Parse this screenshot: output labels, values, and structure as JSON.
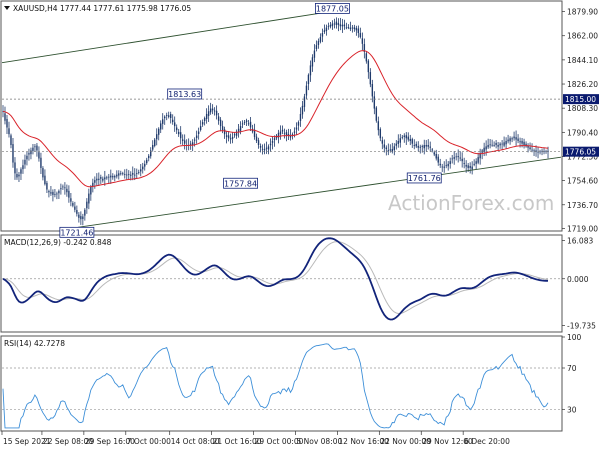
{
  "chart_data": [
    {
      "type": "candlestick",
      "symbol_header": "XAUUSD,H4  1777.44 1777.61 1775.98 1776.05",
      "ylim": [
        1718,
        1887
      ],
      "y_ticks": [
        1879.9,
        1862.0,
        1844.1,
        1826.2,
        1808.3,
        1790.4,
        1772.5,
        1754.6,
        1736.7,
        1719.0
      ],
      "n_bars": 280,
      "close": [
        1806,
        1799,
        1794,
        1789,
        1781,
        1768,
        1760,
        1757,
        1759,
        1763,
        1766,
        1770,
        1773,
        1775,
        1777,
        1779,
        1780,
        1777,
        1771,
        1764,
        1757,
        1752,
        1748,
        1746,
        1745,
        1744,
        1744,
        1745,
        1747,
        1749,
        1750,
        1749,
        1746,
        1742,
        1739,
        1736,
        1733,
        1730,
        1727,
        1726,
        1728,
        1733,
        1739,
        1745,
        1750,
        1753,
        1755,
        1756,
        1756,
        1756,
        1756,
        1757,
        1757,
        1757,
        1757,
        1758,
        1758,
        1759,
        1760,
        1760,
        1760,
        1759,
        1759,
        1759,
        1759,
        1759,
        1759,
        1760,
        1761,
        1763,
        1765,
        1767,
        1770,
        1773,
        1777,
        1781,
        1785,
        1789,
        1793,
        1797,
        1800,
        1802,
        1803,
        1803,
        1801,
        1798,
        1795,
        1792,
        1789,
        1786,
        1784,
        1782,
        1781,
        1781,
        1782,
        1783,
        1785,
        1788,
        1791,
        1795,
        1798,
        1801,
        1804,
        1806,
        1808,
        1808,
        1806,
        1803,
        1799,
        1795,
        1792,
        1789,
        1787,
        1786,
        1786,
        1787,
        1789,
        1791,
        1793,
        1795,
        1797,
        1798,
        1798,
        1797,
        1794,
        1791,
        1787,
        1784,
        1781,
        1779,
        1778,
        1778,
        1779,
        1780,
        1782,
        1784,
        1786,
        1788,
        1790,
        1791,
        1791,
        1790,
        1788,
        1788,
        1788,
        1789,
        1791,
        1794,
        1798,
        1804,
        1810,
        1817,
        1825,
        1833,
        1840,
        1846,
        1851,
        1855,
        1858,
        1861,
        1864,
        1866,
        1868,
        1869,
        1870,
        1871,
        1871,
        1870,
        1870,
        1869,
        1869,
        1869,
        1868,
        1868,
        1868,
        1868,
        1867,
        1866,
        1864,
        1861,
        1856,
        1850,
        1843,
        1835,
        1826,
        1817,
        1808,
        1799,
        1792,
        1786,
        1782,
        1779,
        1778,
        1777,
        1777,
        1778,
        1780,
        1782,
        1784,
        1786,
        1787,
        1787,
        1786,
        1785,
        1784,
        1782,
        1781,
        1780,
        1779,
        1779,
        1780,
        1781,
        1781,
        1781,
        1779,
        1777,
        1774,
        1771,
        1768,
        1766,
        1765,
        1765,
        1766,
        1767,
        1769,
        1771,
        1772,
        1772,
        1772,
        1771,
        1769,
        1767,
        1765,
        1764,
        1764,
        1765,
        1767,
        1769,
        1772,
        1775,
        1777,
        1779,
        1780,
        1781,
        1781,
        1781,
        1781,
        1781,
        1781,
        1782,
        1782,
        1783,
        1784,
        1785,
        1786,
        1786,
        1786,
        1785,
        1784,
        1783,
        1782,
        1781,
        1780,
        1779,
        1778,
        1777,
        1777,
        1776,
        1776,
        1776,
        1776,
        1776,
        1776,
        1776
      ],
      "ema_fast_label": "",
      "price_labels": [
        {
          "text": "1877.05",
          "bar": 165,
          "price": 1877.05,
          "pos": "above"
        },
        {
          "text": "1813.63",
          "bar": 91,
          "price": 1813.63,
          "pos": "above"
        },
        {
          "text": "1757.84",
          "bar": 119,
          "price": 1757.84,
          "pos": "below"
        },
        {
          "text": "1721.46",
          "bar": 37,
          "price": 1721.46,
          "pos": "below"
        },
        {
          "text": "1761.76",
          "bar": 211,
          "price": 1761.76,
          "pos": "below"
        }
      ],
      "levels": [
        {
          "price": 1815.0,
          "text": "1815.00"
        },
        {
          "price": 1776.05,
          "text": "1776.05"
        }
      ],
      "channel_upper": [
        [
          0,
          1842
        ],
        [
          165,
          1880
        ]
      ],
      "channel_lower": [
        [
          38,
          1720
        ],
        [
          280,
          1772
        ]
      ],
      "colors": {
        "candle": "#1f3a6b",
        "ma": "#d9232a",
        "channel": "#2f5130",
        "level_tag": "#0a1a6e"
      },
      "watermark": "ActionForex.com"
    },
    {
      "type": "line",
      "header": "MACD(12,26,9) -0.242 0.848",
      "ylim": [
        -22,
        18
      ],
      "y_ticks": [
        16.083,
        0.0,
        -19.735
      ],
      "zero_line": 0,
      "colors": {
        "macd": "#12247a",
        "signal": "#b9b9b9"
      }
    },
    {
      "type": "line",
      "header": "RSI(14) 42.7278",
      "ylim": [
        10,
        100
      ],
      "y_ticks": [
        100,
        70,
        30,
        0
      ],
      "ref_lines": [
        70,
        30
      ],
      "colors": {
        "rsi": "#3d8fd8"
      }
    }
  ],
  "x_axis": {
    "labels": [
      "15 Sep 2021",
      "22 Sep 08:00",
      "29 Sep 16:00",
      "7 Oct 00:00",
      "14 Oct 08:00",
      "21 Oct 16:00",
      "29 Oct 00:00",
      "5 Nov 08:00",
      "12 Nov 16:00",
      "22 Nov 00:00",
      "29 Nov 12:00",
      "6 Dec 20:00"
    ],
    "label_bars": [
      0,
      20,
      41,
      62,
      84,
      105,
      126,
      147,
      168,
      189,
      210,
      231
    ]
  }
}
